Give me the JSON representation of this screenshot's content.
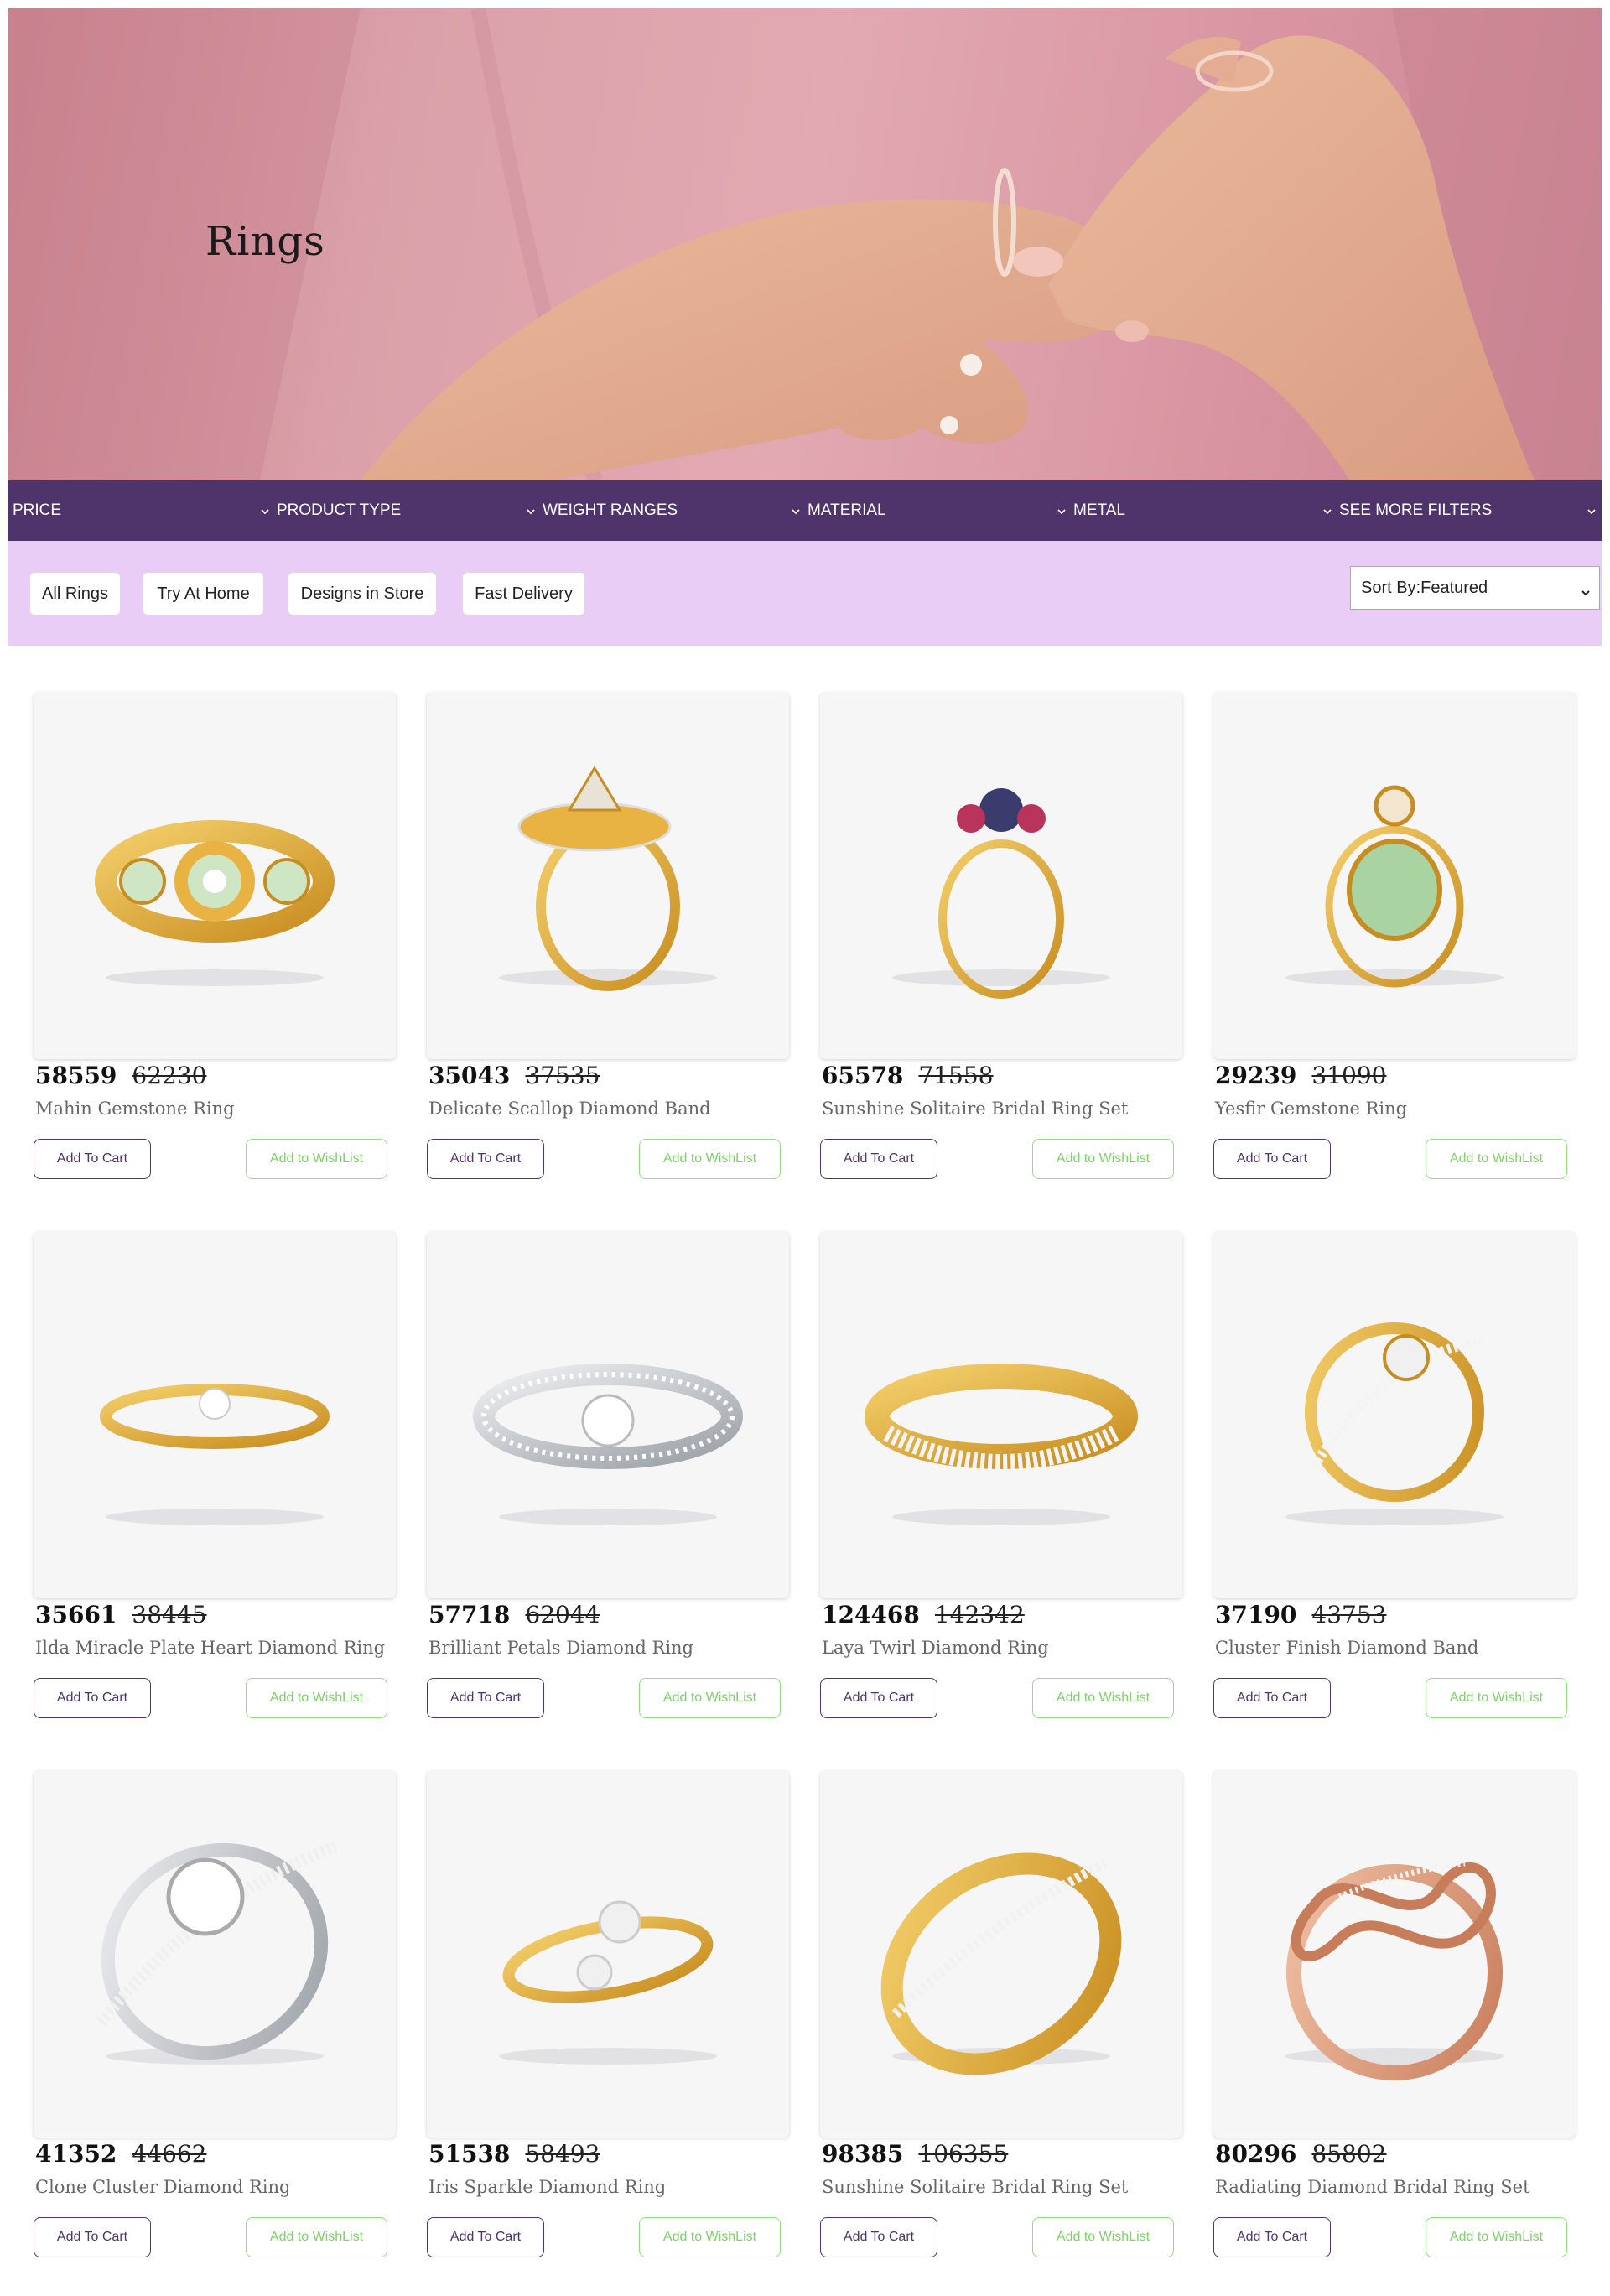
{
  "hero": {
    "title": "Rings",
    "background_color": "#dca3ac"
  },
  "filters": [
    {
      "label": "PRICE"
    },
    {
      "label": "PRODUCT TYPE"
    },
    {
      "label": "WEIGHT RANGES"
    },
    {
      "label": "MATERIAL"
    },
    {
      "label": "METAL"
    },
    {
      "label": "SEE MORE FILTERS"
    }
  ],
  "chips": [
    {
      "label": "All Rings"
    },
    {
      "label": "Try At Home"
    },
    {
      "label": "Designs in Store"
    },
    {
      "label": "Fast Delivery"
    }
  ],
  "sort": {
    "label": "Sort By:Featured"
  },
  "colors": {
    "filter_bar": "#4e346a",
    "chip_bar": "#eacdf7",
    "cart_button": "#4e346a",
    "wishlist_button": "#7cd266"
  },
  "products": [
    {
      "price": "58559",
      "mrp": "62230",
      "name": "Mahin Gemstone Ring",
      "cart_label": "Add To Cart",
      "wishlist_label": "Add to WishList",
      "metal": "yellow gold"
    },
    {
      "price": "35043",
      "mrp": "37535",
      "name": "Delicate Scallop Diamond Band",
      "cart_label": "Add To Cart",
      "wishlist_label": "Add to WishList",
      "metal": "yellow gold"
    },
    {
      "price": "65578",
      "mrp": "71558",
      "name": "Sunshine Solitaire Bridal Ring Set",
      "cart_label": "Add To Cart",
      "wishlist_label": "Add to WishList",
      "metal": "yellow gold"
    },
    {
      "price": "29239",
      "mrp": "31090",
      "name": "Yesfir Gemstone Ring",
      "cart_label": "Add To Cart",
      "wishlist_label": "Add to WishList",
      "metal": "yellow gold"
    },
    {
      "price": "35661",
      "mrp": "38445",
      "name": "Ilda Miracle Plate Heart Diamond Ring",
      "cart_label": "Add To Cart",
      "wishlist_label": "Add to WishList",
      "metal": "yellow gold"
    },
    {
      "price": "57718",
      "mrp": "62044",
      "name": "Brilliant Petals Diamond Ring",
      "cart_label": "Add To Cart",
      "wishlist_label": "Add to WishList",
      "metal": "white gold"
    },
    {
      "price": "124468",
      "mrp": "142342",
      "name": "Laya Twirl Diamond Ring",
      "cart_label": "Add To Cart",
      "wishlist_label": "Add to WishList",
      "metal": "yellow gold"
    },
    {
      "price": "37190",
      "mrp": "43753",
      "name": "Cluster Finish Diamond Band",
      "cart_label": "Add To Cart",
      "wishlist_label": "Add to WishList",
      "metal": "yellow gold"
    },
    {
      "price": "41352",
      "mrp": "44662",
      "name": "Clone Cluster Diamond Ring",
      "cart_label": "Add To Cart",
      "wishlist_label": "Add to WishList",
      "metal": "white gold"
    },
    {
      "price": "51538",
      "mrp": "58493",
      "name": "Iris Sparkle Diamond Ring",
      "cart_label": "Add To Cart",
      "wishlist_label": "Add to WishList",
      "metal": "yellow gold"
    },
    {
      "price": "98385",
      "mrp": "106355",
      "name": "Sunshine Solitaire Bridal Ring Set",
      "cart_label": "Add To Cart",
      "wishlist_label": "Add to WishList",
      "metal": "yellow gold"
    },
    {
      "price": "80296",
      "mrp": "85802",
      "name": "Radiating Diamond Bridal Ring Set",
      "cart_label": "Add To Cart",
      "wishlist_label": "Add to WishList",
      "metal": "rose gold"
    }
  ]
}
